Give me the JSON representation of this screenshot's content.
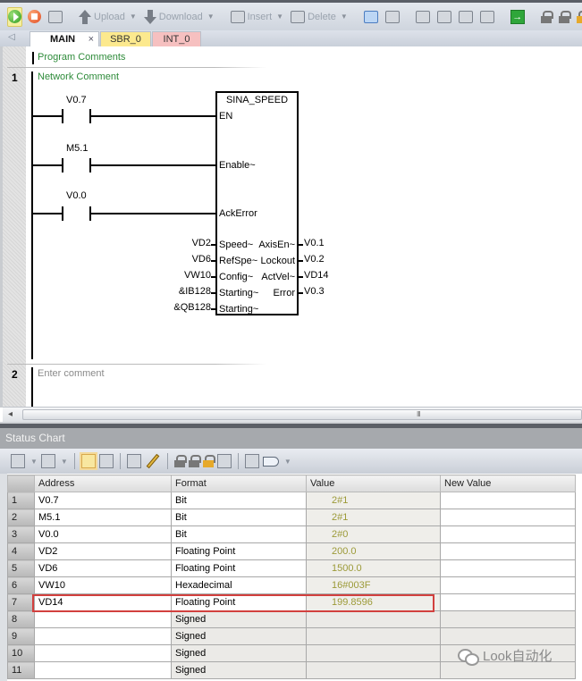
{
  "toolbar": {
    "upload_label": "Upload",
    "download_label": "Download",
    "insert_label": "Insert",
    "delete_label": "Delete",
    "icons": [
      "run-icon",
      "stop-icon",
      "compile-icon",
      "upload-icon",
      "download-icon",
      "insert-icon",
      "delete-icon",
      "program-status-icon",
      "trend-icon",
      "bookmark-icon",
      "bookmark-prev-icon",
      "bookmark-next-icon",
      "bookmark-clear-icon",
      "goto-icon",
      "lock-icon",
      "unlock-icon",
      "protect-icon"
    ]
  },
  "tabs": [
    {
      "label": "MAIN",
      "close": "×",
      "color": "#ffffff"
    },
    {
      "label": "SBR_0",
      "color": "#fce98e"
    },
    {
      "label": "INT_0",
      "color": "#f6c0c0"
    }
  ],
  "editor": {
    "program_comment": "Program Comments",
    "networks": [
      {
        "number": "1",
        "comment": "Network Comment",
        "contacts": [
          {
            "address": "V0.7"
          },
          {
            "address": "M5.1"
          },
          {
            "address": "V0.0"
          }
        ],
        "block": {
          "title": "SINA_SPEED",
          "en_pin": "EN",
          "bool_inputs": [
            "Enable~",
            "AckError"
          ],
          "inputs": [
            {
              "operand": "VD2",
              "pin": "Speed~"
            },
            {
              "operand": "VD6",
              "pin": "RefSpe~"
            },
            {
              "operand": "VW10",
              "pin": "Config~"
            },
            {
              "operand": "&IB128",
              "pin": "Starting~"
            },
            {
              "operand": "&QB128",
              "pin": "Starting~"
            }
          ],
          "outputs": [
            {
              "pin": "AxisEn~",
              "operand": "V0.1"
            },
            {
              "pin": "Lockout",
              "operand": "V0.2"
            },
            {
              "pin": "ActVel~",
              "operand": "VD14"
            },
            {
              "pin": "Error",
              "operand": "V0.3"
            }
          ]
        }
      },
      {
        "number": "2",
        "comment": "Enter comment"
      }
    ],
    "scroll_grip": "III"
  },
  "status_chart": {
    "title": "Status Chart",
    "columns": [
      "",
      "Address",
      "Format",
      "Value",
      "New Value"
    ],
    "rows": [
      {
        "n": "1",
        "address": "V0.7",
        "format": "Bit",
        "value": "2#1",
        "new_value": ""
      },
      {
        "n": "2",
        "address": "M5.1",
        "format": "Bit",
        "value": "2#1",
        "new_value": ""
      },
      {
        "n": "3",
        "address": "V0.0",
        "format": "Bit",
        "value": "2#0",
        "new_value": ""
      },
      {
        "n": "4",
        "address": "VD2",
        "format": "Floating Point",
        "value": "200.0",
        "new_value": ""
      },
      {
        "n": "5",
        "address": "VD6",
        "format": "Floating Point",
        "value": "1500.0",
        "new_value": ""
      },
      {
        "n": "6",
        "address": "VW10",
        "format": "Hexadecimal",
        "value": "16#003F",
        "new_value": ""
      },
      {
        "n": "7",
        "address": "VD14",
        "format": "Floating Point",
        "value": "199.8596",
        "new_value": "",
        "highlighted": true
      },
      {
        "n": "8",
        "address": "",
        "format": "Signed",
        "value": "",
        "new_value": ""
      },
      {
        "n": "9",
        "address": "",
        "format": "Signed",
        "value": "",
        "new_value": ""
      },
      {
        "n": "10",
        "address": "",
        "format": "Signed",
        "value": "",
        "new_value": ""
      },
      {
        "n": "11",
        "address": "",
        "format": "Signed",
        "value": "",
        "new_value": ""
      }
    ],
    "highlight_color": "#d2403e",
    "value_color": "#9c9a38"
  },
  "watermark": {
    "text": "Look自动化"
  }
}
